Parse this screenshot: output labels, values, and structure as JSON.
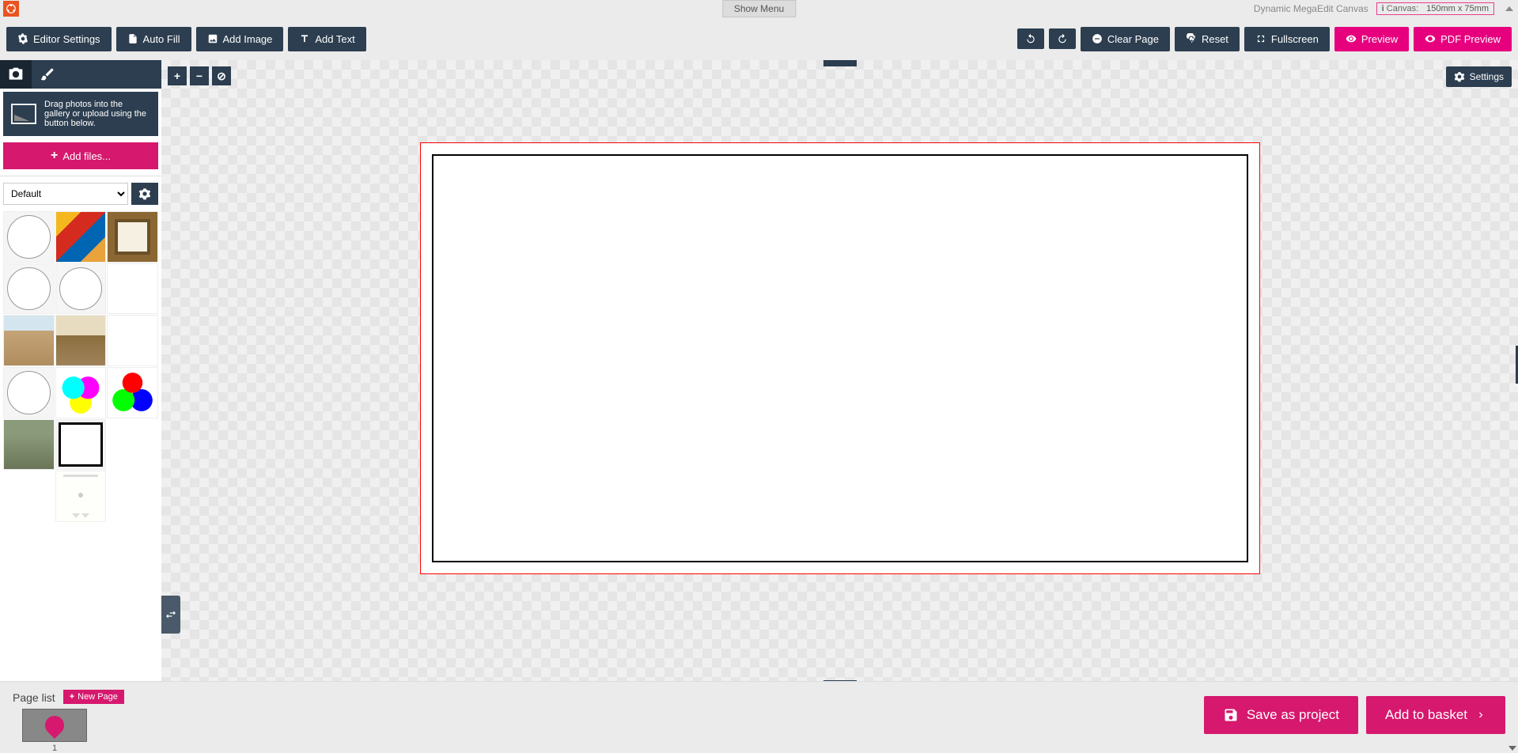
{
  "topbar": {
    "show_menu": "Show Menu",
    "app_title": "Dynamic MegaEdit Canvas",
    "canvas_label": "Canvas:",
    "canvas_size": "150mm x 75mm"
  },
  "toolbar": {
    "editor_settings": "Editor Settings",
    "auto_fill": "Auto Fill",
    "add_image": "Add Image",
    "add_text": "Add Text",
    "clear_page": "Clear Page",
    "reset": "Reset",
    "fullscreen": "Fullscreen",
    "preview": "Preview",
    "pdf_preview": "PDF Preview"
  },
  "sidebar": {
    "upload_hint": "Drag photos into the gallery or upload using the button below.",
    "add_files": "Add files...",
    "album_select": "Default"
  },
  "canvas": {
    "settings": "Settings"
  },
  "bottom": {
    "page_list": "Page list",
    "new_page": "New Page",
    "page_num": "1",
    "save_project": "Save as project",
    "add_basket": "Add to basket"
  }
}
